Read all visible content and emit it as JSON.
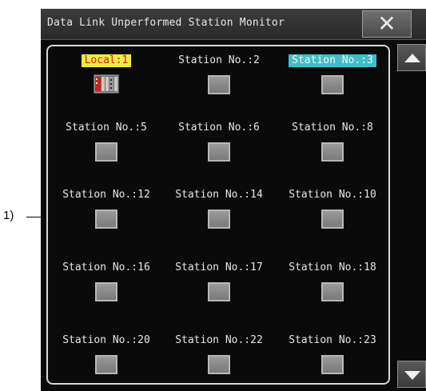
{
  "callout_label": "1)",
  "window": {
    "title": "Data Link Unperformed Station Monitor",
    "close_icon": "close-icon"
  },
  "stations": [
    {
      "label": "Local:1",
      "style": "local",
      "icon": "plc-module-icon"
    },
    {
      "label": "Station No.:2",
      "style": "normal",
      "icon": "station-icon"
    },
    {
      "label": "Station No.:3",
      "style": "highlight",
      "icon": "station-icon"
    },
    {
      "label": "Station No.:5",
      "style": "normal",
      "icon": "station-icon"
    },
    {
      "label": "Station No.:6",
      "style": "normal",
      "icon": "station-icon"
    },
    {
      "label": "Station No.:8",
      "style": "normal",
      "icon": "station-icon"
    },
    {
      "label": "Station No.:12",
      "style": "normal",
      "icon": "station-icon"
    },
    {
      "label": "Station No.:14",
      "style": "normal",
      "icon": "station-icon"
    },
    {
      "label": "Station No.:10",
      "style": "normal",
      "icon": "station-icon"
    },
    {
      "label": "Station No.:16",
      "style": "normal",
      "icon": "station-icon"
    },
    {
      "label": "Station No.:17",
      "style": "normal",
      "icon": "station-icon"
    },
    {
      "label": "Station No.:18",
      "style": "normal",
      "icon": "station-icon"
    },
    {
      "label": "Station No.:20",
      "style": "normal",
      "icon": "station-icon"
    },
    {
      "label": "Station No.:22",
      "style": "normal",
      "icon": "station-icon"
    },
    {
      "label": "Station No.:23",
      "style": "normal",
      "icon": "station-icon"
    }
  ],
  "scrollbar": {
    "up_icon": "scroll-up-icon",
    "down_icon": "scroll-down-icon"
  },
  "colors": {
    "local_label_bg": "#f0ec3c",
    "local_label_text": "#d02020",
    "highlight_label_bg": "#3cc0c8",
    "background": "#0a0a0a"
  }
}
